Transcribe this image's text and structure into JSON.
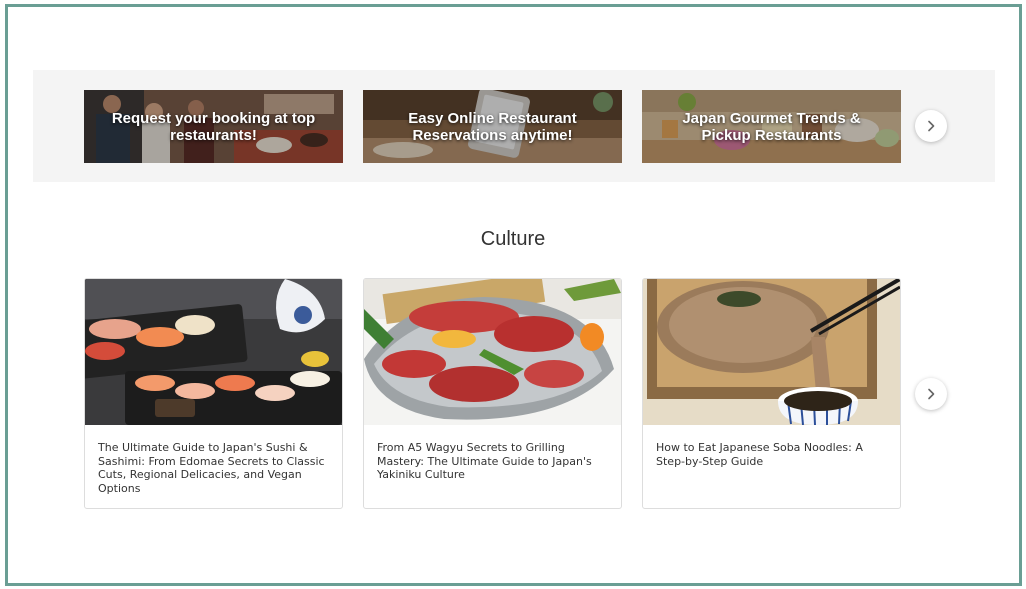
{
  "banners": [
    {
      "label": "Request your booking at top restaurants!"
    },
    {
      "label": "Easy Online Restaurant Reservations anytime!"
    },
    {
      "label": "Japan Gourmet Trends & Pickup Restaurants"
    }
  ],
  "section": {
    "title": "Culture"
  },
  "articles": [
    {
      "title": "The Ultimate Guide to Japan's Sushi & Sashimi: From Edomae Secrets to Classic Cuts, Regional Delicacies, and Vegan Options"
    },
    {
      "title": "From A5 Wagyu Secrets to Grilling Mastery: The Ultimate Guide to Japan's Yakiniku Culture"
    },
    {
      "title": "How to Eat Japanese Soba Noodles: A Step-by-Step Guide"
    }
  ],
  "icons": {
    "next": "chevron-right-icon"
  },
  "colors": {
    "frame": "#6a9e94",
    "strip": "#f4f4f4",
    "text": "#333333"
  }
}
